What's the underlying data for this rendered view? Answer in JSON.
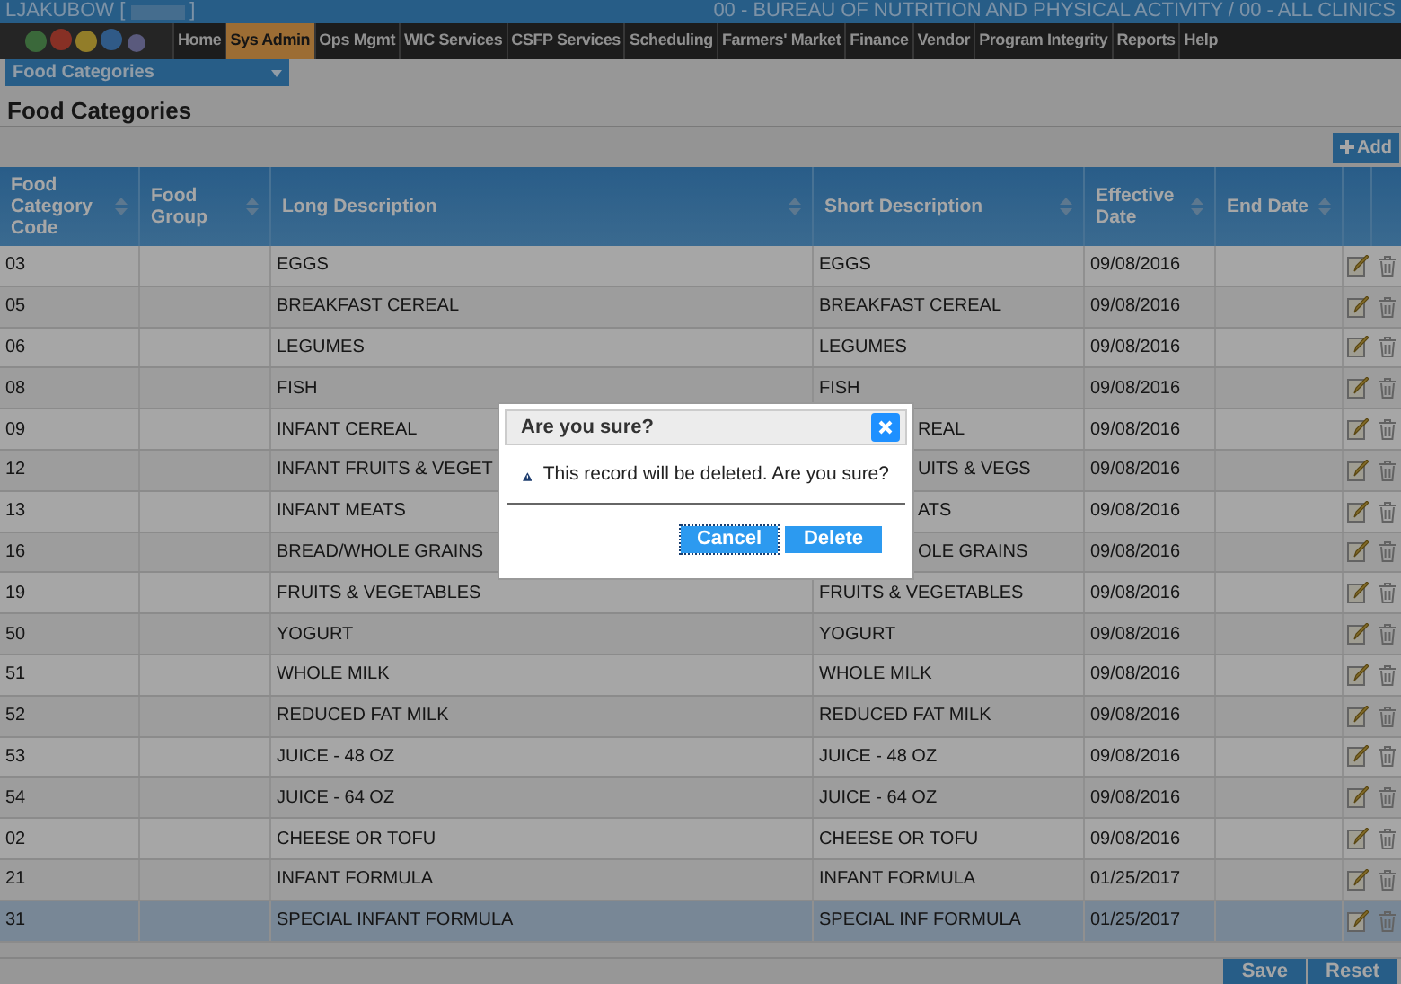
{
  "top_bar": {
    "user": "LJAKUBOW [",
    "user_end": "]",
    "agency": "00 - BUREAU OF NUTRITION AND PHYSICAL ACTIVITY / 00 - ALL CLINICS"
  },
  "nav": [
    {
      "label": "Home",
      "selected": false
    },
    {
      "label": "Sys Admin",
      "selected": true
    },
    {
      "label": "Ops Mgmt",
      "selected": false
    },
    {
      "label": "WIC Services",
      "selected": false
    },
    {
      "label": "CSFP Services",
      "selected": false
    },
    {
      "label": "Scheduling",
      "selected": false
    },
    {
      "label": "Farmers' Market",
      "selected": false
    },
    {
      "label": "Finance",
      "selected": false
    },
    {
      "label": "Vendor",
      "selected": false
    },
    {
      "label": "Program Integrity",
      "selected": false
    },
    {
      "label": "Reports",
      "selected": false
    },
    {
      "label": "Help",
      "selected": false
    }
  ],
  "page_select": {
    "value": "Food Categories"
  },
  "title": "Food Categories",
  "add_button": "Add",
  "table": {
    "columns": [
      "Food Category Code",
      "Food Group",
      "Long Description",
      "Short Description",
      "Effective Date",
      "End Date"
    ],
    "rows": [
      {
        "code": "03",
        "group": "",
        "long": "EGGS",
        "short": "EGGS",
        "effective": "09/08/2016",
        "end": "",
        "selected": false,
        "short_covered": false
      },
      {
        "code": "05",
        "group": "",
        "long": "BREAKFAST CEREAL",
        "short": "BREAKFAST CEREAL",
        "effective": "09/08/2016",
        "end": "",
        "selected": false,
        "short_covered": false
      },
      {
        "code": "06",
        "group": "",
        "long": "LEGUMES",
        "short": "LEGUMES",
        "effective": "09/08/2016",
        "end": "",
        "selected": false,
        "short_covered": false
      },
      {
        "code": "08",
        "group": "",
        "long": "FISH",
        "short": "FISH",
        "effective": "09/08/2016",
        "end": "",
        "selected": false,
        "short_covered": false
      },
      {
        "code": "09",
        "group": "",
        "long": "INFANT CEREAL",
        "short": "REAL",
        "effective": "09/08/2016",
        "end": "",
        "selected": false,
        "short_covered": true
      },
      {
        "code": "12",
        "group": "",
        "long": "INFANT FRUITS & VEGET",
        "short": "UITS & VEGS",
        "effective": "09/08/2016",
        "end": "",
        "selected": false,
        "short_covered": true
      },
      {
        "code": "13",
        "group": "",
        "long": "INFANT MEATS",
        "short": "ATS",
        "effective": "09/08/2016",
        "end": "",
        "selected": false,
        "short_covered": true
      },
      {
        "code": "16",
        "group": "",
        "long": "BREAD/WHOLE GRAINS",
        "short": "OLE GRAINS",
        "effective": "09/08/2016",
        "end": "",
        "selected": false,
        "short_covered": true
      },
      {
        "code": "19",
        "group": "",
        "long": "FRUITS & VEGETABLES",
        "short": "FRUITS & VEGETABLES",
        "effective": "09/08/2016",
        "end": "",
        "selected": false,
        "short_covered": false
      },
      {
        "code": "50",
        "group": "",
        "long": "YOGURT",
        "short": "YOGURT",
        "effective": "09/08/2016",
        "end": "",
        "selected": false,
        "short_covered": false
      },
      {
        "code": "51",
        "group": "",
        "long": "WHOLE MILK",
        "short": "WHOLE MILK",
        "effective": "09/08/2016",
        "end": "",
        "selected": false,
        "short_covered": false
      },
      {
        "code": "52",
        "group": "",
        "long": "REDUCED FAT MILK",
        "short": "REDUCED FAT MILK",
        "effective": "09/08/2016",
        "end": "",
        "selected": false,
        "short_covered": false
      },
      {
        "code": "53",
        "group": "",
        "long": "JUICE - 48 OZ",
        "short": "JUICE - 48 OZ",
        "effective": "09/08/2016",
        "end": "",
        "selected": false,
        "short_covered": false
      },
      {
        "code": "54",
        "group": "",
        "long": "JUICE - 64 OZ",
        "short": "JUICE - 64 OZ",
        "effective": "09/08/2016",
        "end": "",
        "selected": false,
        "short_covered": false
      },
      {
        "code": "02",
        "group": "",
        "long": "CHEESE OR TOFU",
        "short": "CHEESE OR TOFU",
        "effective": "09/08/2016",
        "end": "",
        "selected": false,
        "short_covered": false
      },
      {
        "code": "21",
        "group": "",
        "long": "INFANT FORMULA",
        "short": "INFANT FORMULA",
        "effective": "01/25/2017",
        "end": "",
        "selected": false,
        "short_covered": false
      },
      {
        "code": "31",
        "group": "",
        "long": "SPECIAL INFANT FORMULA",
        "short": "SPECIAL INF FORMULA",
        "effective": "01/25/2017",
        "end": "",
        "selected": true,
        "short_covered": false
      }
    ]
  },
  "footer_buttons": [
    "Save",
    "Reset"
  ],
  "dialog": {
    "title": "Are you sure?",
    "message": "This record will be deleted. Are you sure?",
    "buttons": [
      {
        "label": "Cancel",
        "focused": true
      },
      {
        "label": "Delete",
        "focused": false
      }
    ]
  }
}
